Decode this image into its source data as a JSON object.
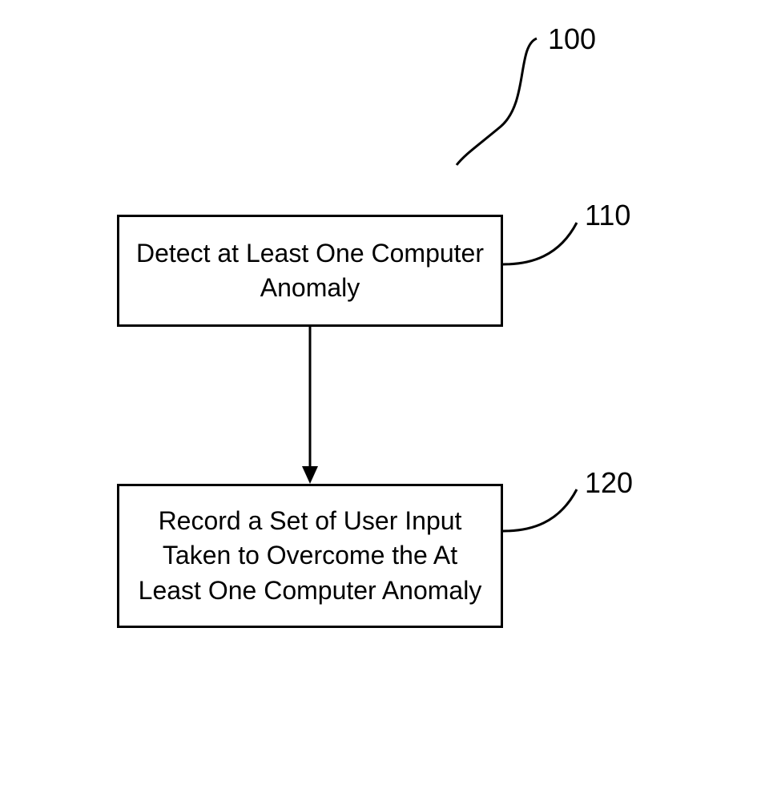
{
  "diagram": {
    "title_label": "100",
    "boxes": [
      {
        "id": "box-110",
        "text": "Detect at Least One Computer Anomaly",
        "label": "110"
      },
      {
        "id": "box-120",
        "text": "Record a Set of User Input Taken to Overcome the At Least One Computer Anomaly",
        "label": "120"
      }
    ]
  }
}
